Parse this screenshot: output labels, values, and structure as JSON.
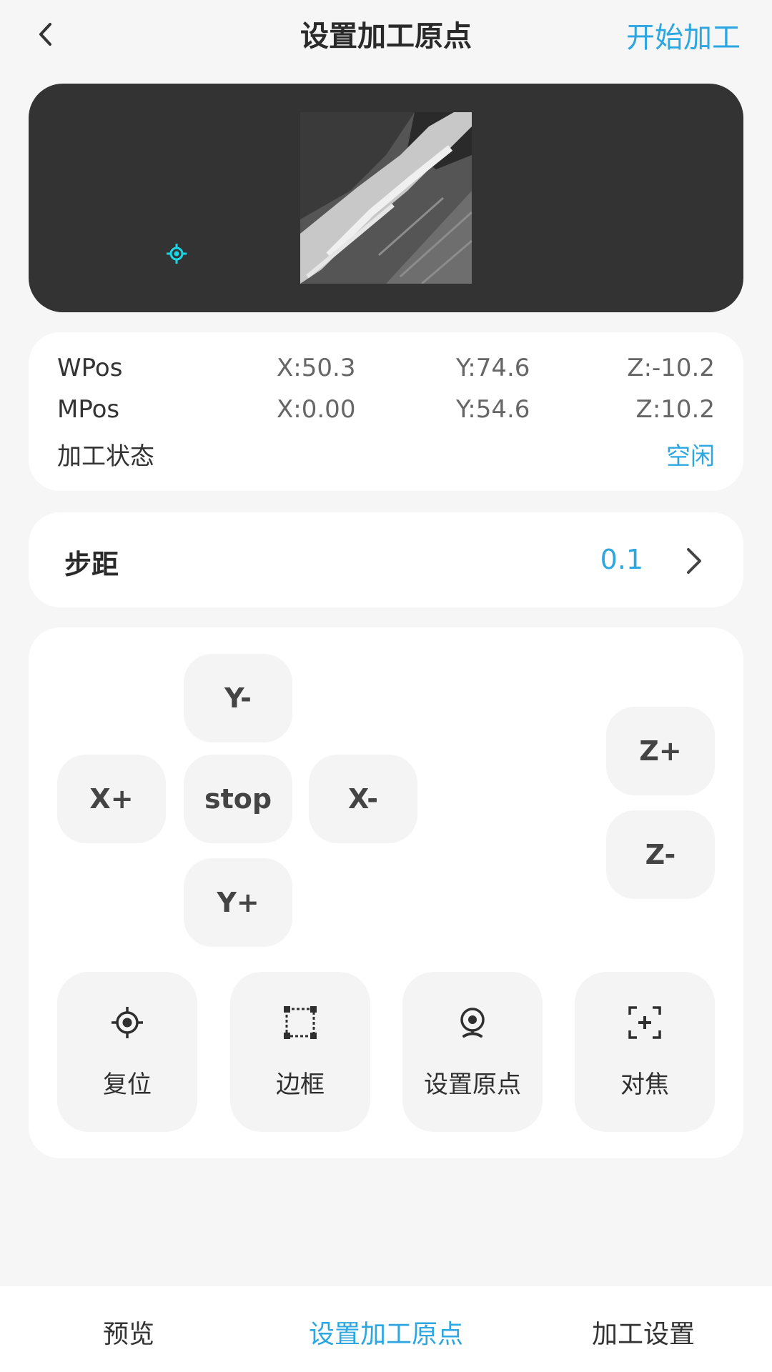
{
  "header": {
    "title": "设置加工原点",
    "action_label": "开始加工",
    "back_icon": "chevron-left-icon"
  },
  "preview": {
    "image_alt": "ocean waves aerial grayscale",
    "origin_marker_icon": "crosshair-icon",
    "marker_color": "#19d6e6"
  },
  "position": {
    "rows": [
      {
        "label": "WPos",
        "x": "X:50.3",
        "y": "Y:74.6",
        "z": "Z:-10.2"
      },
      {
        "label": "MPos",
        "x": "X:0.00",
        "y": "Y:54.6",
        "z": "Z:10.2"
      }
    ],
    "status_label": "加工状态",
    "status_value": "空闲"
  },
  "step": {
    "label": "步距",
    "value": "0.1",
    "chevron_icon": "chevron-right-icon"
  },
  "jog": {
    "y_minus": "Y-",
    "x_plus": "X+",
    "stop": "stop",
    "x_minus": "X-",
    "y_plus": "Y+",
    "z_plus": "Z+",
    "z_minus": "Z-"
  },
  "tools": [
    {
      "label": "复位",
      "icon": "crosshair-icon"
    },
    {
      "label": "边框",
      "icon": "frame-icon"
    },
    {
      "label": "设置原点",
      "icon": "location-pin-icon"
    },
    {
      "label": "对焦",
      "icon": "focus-icon"
    }
  ],
  "tabs": [
    {
      "label": "预览",
      "active": false
    },
    {
      "label": "设置加工原点",
      "active": true
    },
    {
      "label": "加工设置",
      "active": false
    }
  ],
  "colors": {
    "accent": "#2ea7e0",
    "preview_bg": "#333333",
    "page_bg": "#f6f6f6"
  }
}
